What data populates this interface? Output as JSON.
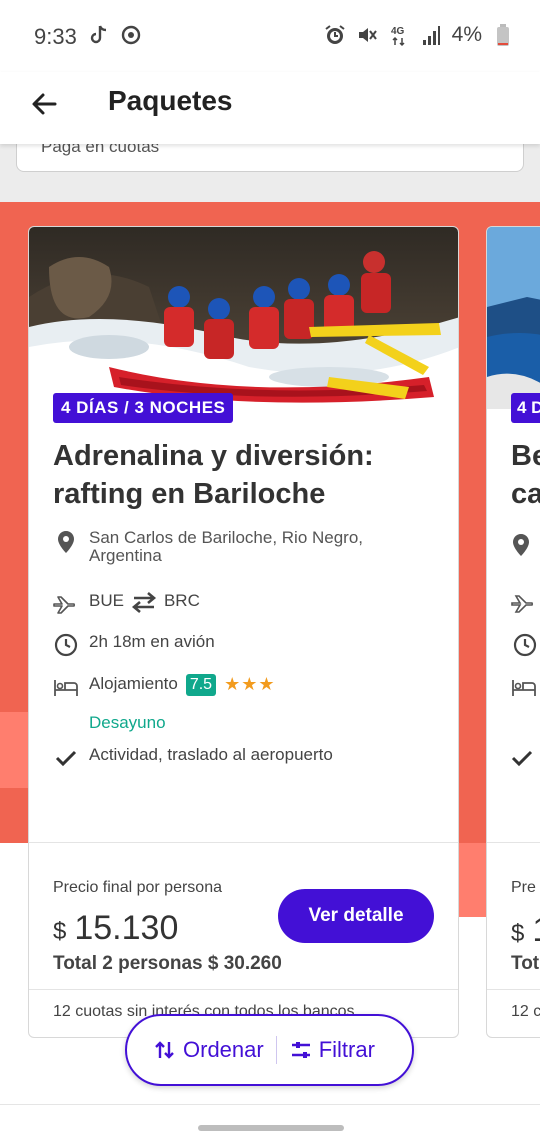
{
  "status_bar": {
    "time": "9:33",
    "battery": "4%",
    "network": "4G",
    "icons": [
      "tiktok-icon",
      "sync-icon",
      "alarm-icon",
      "mute-icon",
      "network-icon",
      "signal-icon",
      "battery-icon"
    ]
  },
  "app_bar": {
    "title": "Paquetes",
    "back_icon": "arrow-left-icon"
  },
  "top_banner": {
    "text": "Paga en cuotas"
  },
  "card": {
    "duration_badge": "4 DÍAS / 3 NOCHES",
    "title": "Adrenalina y diversión: rafting en Bariloche",
    "location": "San Carlos de Bariloche, Rio Negro, Argentina",
    "route_from": "BUE",
    "route_to": "BRC",
    "flight_time": "2h 18m en avión",
    "lodging_label": "Alojamiento",
    "lodging_score": "7.5",
    "stars": "★★★",
    "meal": "Desayuno",
    "activity": "Actividad, traslado al aeropuerto",
    "price_label": "Precio final por persona",
    "currency": "$",
    "price": "15.130",
    "total": "Total 2 personas $ 30.260",
    "detail_button": "Ver detalle",
    "installments": "12 cuotas sin interés con todos los bancos"
  },
  "next_card": {
    "duration_badge": "4 D",
    "title": "Be\nca",
    "price_label": "Pre",
    "currency": "$",
    "price": "1",
    "total": "Tot",
    "installments": "12 c"
  },
  "actions": {
    "sort": "Ordenar",
    "filter": "Filtrar"
  },
  "colors": {
    "primary": "#4310d6",
    "accent_red": "#f06451",
    "accent_red_light": "#ff7e6e",
    "green": "#10a88c",
    "star": "#f29b1e"
  }
}
